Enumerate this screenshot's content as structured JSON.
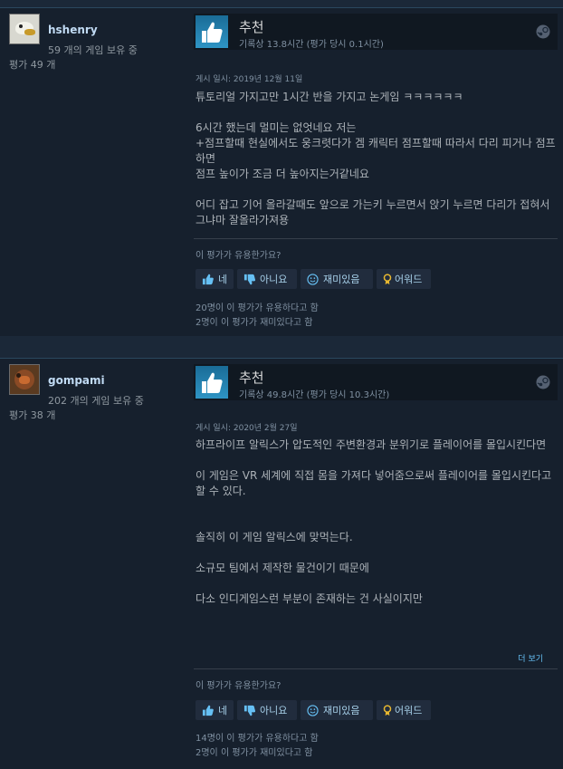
{
  "reviews": [
    {
      "author": "hshenry",
      "games_owned": "59 개의 게임 보유 중",
      "review_count": "평가 49 개",
      "verdict": "추천",
      "hours": "기록상 13.8시간 (평가 당시 0.1시간)",
      "posted": "게시 일시: 2019년 12월 11일",
      "paragraphs": [
        "튜토리얼 가지고만 1시간 반을 가지고 논게임 ㅋㅋㅋㅋㅋㅋ",
        "6시간 했는데 멀미는 없엇네요 저는\n+점프할때 현실에서도 웅크렷다가 겜 캐릭터 점프할때 따라서 다리 피거나 점프하면\n점프 높이가 조금 더 높아지는거같네요",
        "어디 잡고 기어 올라갈때도 앞으로 가는키 누르면서 앉기 누르면 다리가 접혀서 그냐마 잘올라가져용"
      ],
      "helpful_question": "이 평가가 유용한가요?",
      "btn_yes": "네",
      "btn_no": "아니요",
      "btn_funny": "재미있음",
      "btn_award": "어워드",
      "helpful_count": "20명이 이 평가가 유용하다고 함",
      "funny_count": "2명이 이 평가가 재미있다고 함"
    },
    {
      "author": "gompami",
      "games_owned": "202 개의 게임 보유 중",
      "review_count": "평가 38 개",
      "verdict": "추천",
      "hours": "기록상 49.8시간 (평가 당시 10.3시간)",
      "posted": "게시 일시: 2020년 2월 27일",
      "paragraphs": [
        "하프라이프 알릭스가 압도적인 주변환경과 분위기로 플레이어를 몰입시킨다면",
        "이 게임은 VR 세계에 직접 몸을 가져다 넣어줌으로써 플레이어를 몰입시킨다고 할 수 있다.",
        "",
        "솔직히 이 게임 알릭스에 맞먹는다.",
        "소규모 팀에서 제작한 물건이기 때문에",
        "다소 인디게임스런 부분이 존재하는 건 사실이지만"
      ],
      "read_more": "더 보기",
      "helpful_question": "이 평가가 유용한가요?",
      "btn_yes": "네",
      "btn_no": "아니요",
      "btn_funny": "재미있음",
      "btn_award": "어워드",
      "helpful_count": "14명이 이 평가가 유용하다고 함",
      "funny_count": "2명이 이 평가가 재미있다고 함"
    }
  ],
  "icons": {
    "thumbs_up": "thumbs-up-icon",
    "thumbs_down": "thumbs-down-icon",
    "smiley": "smiley-icon",
    "award": "award-icon",
    "steam": "steam-icon"
  },
  "colors": {
    "background": "#1b2838",
    "card": "#16202d",
    "link": "#66c0f4",
    "recommend_blue": "#2e94c4"
  }
}
